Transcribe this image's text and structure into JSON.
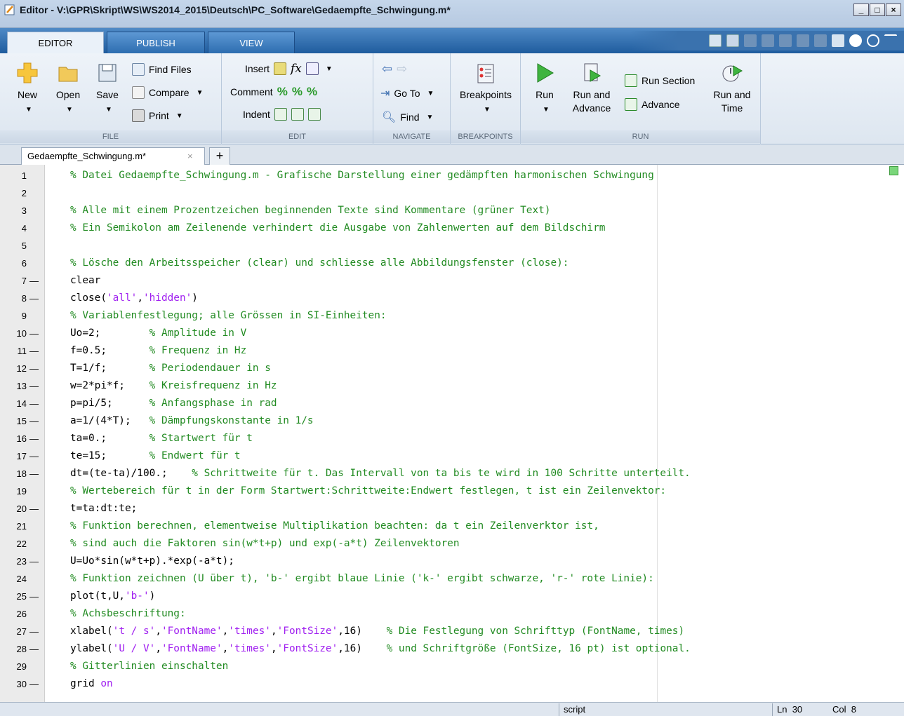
{
  "window": {
    "title": "Editor - V:\\GPR\\Skript\\WS\\WS2014_2015\\Deutsch\\PC_Software\\Gedaempfte_Schwingung.m*",
    "min_glyph": "_",
    "max_glyph": "□",
    "close_glyph": "×"
  },
  "tabs": [
    {
      "label": "EDITOR"
    },
    {
      "label": "PUBLISH"
    },
    {
      "label": "VIEW"
    }
  ],
  "ribbon": {
    "file": {
      "label": "FILE",
      "new": "New",
      "open": "Open",
      "save": "Save",
      "find_files": "Find Files",
      "compare": "Compare",
      "print": "Print"
    },
    "edit": {
      "label": "EDIT",
      "insert": "Insert",
      "comment": "Comment",
      "indent": "Indent"
    },
    "navigate": {
      "label": "NAVIGATE",
      "goto": "Go To",
      "find": "Find"
    },
    "breakpoints": {
      "label": "BREAKPOINTS",
      "breakpoints": "Breakpoints"
    },
    "run": {
      "label": "RUN",
      "run": "Run",
      "run_and_advance_1": "Run and",
      "run_and_advance_2": "Advance",
      "run_section": "Run Section",
      "advance": "Advance",
      "run_and_time_1": "Run and",
      "run_and_time_2": "Time"
    }
  },
  "doc_tab": {
    "label": "Gedaempfte_Schwingung.m*",
    "close": "×",
    "add": "+"
  },
  "lines": [
    {
      "n": "1",
      "b": "",
      "c": "% Datei Gedaempfte_Schwingung.m - Grafische Darstellung einer gedämpften harmonischen Schwingung"
    },
    {
      "n": "2",
      "b": "",
      "c": ""
    },
    {
      "n": "3",
      "b": "",
      "c": "% Alle mit einem Prozentzeichen beginnenden Texte sind Kommentare (grüner Text)"
    },
    {
      "n": "4",
      "b": "",
      "c": "% Ein Semikolon am Zeilenende verhindert die Ausgabe von Zahlenwerten auf dem Bildschirm"
    },
    {
      "n": "5",
      "b": "",
      "c": ""
    },
    {
      "n": "6",
      "b": "",
      "c": "% Lösche den Arbeitsspeicher (clear) und schliesse alle Abbildungsfenster (close):"
    },
    {
      "n": "7",
      "b": "-",
      "c": "clear"
    },
    {
      "n": "8",
      "b": "-",
      "c": "close('all','hidden')"
    },
    {
      "n": "9",
      "b": "",
      "c": "% Variablenfestlegung; alle Grössen in SI-Einheiten:"
    },
    {
      "n": "10",
      "b": "-",
      "c": "Uo=2;        % Amplitude in V"
    },
    {
      "n": "11",
      "b": "-",
      "c": "f=0.5;       % Frequenz in Hz"
    },
    {
      "n": "12",
      "b": "-",
      "c": "T=1/f;       % Periodendauer in s"
    },
    {
      "n": "13",
      "b": "-",
      "c": "w=2*pi*f;    % Kreisfrequenz in Hz"
    },
    {
      "n": "14",
      "b": "-",
      "c": "p=pi/5;      % Anfangsphase in rad"
    },
    {
      "n": "15",
      "b": "-",
      "c": "a=1/(4*T);   % Dämpfungskonstante in 1/s"
    },
    {
      "n": "16",
      "b": "-",
      "c": "ta=0.;       % Startwert für t"
    },
    {
      "n": "17",
      "b": "-",
      "c": "te=15;       % Endwert für t"
    },
    {
      "n": "18",
      "b": "-",
      "c": "dt=(te-ta)/100.;    % Schrittweite für t. Das Intervall von ta bis te wird in 100 Schritte unterteilt."
    },
    {
      "n": "19",
      "b": "",
      "c": "% Wertebereich für t in der Form Startwert:Schrittweite:Endwert festlegen, t ist ein Zeilenvektor:"
    },
    {
      "n": "20",
      "b": "-",
      "c": "t=ta:dt:te;"
    },
    {
      "n": "21",
      "b": "",
      "c": "% Funktion berechnen, elementweise Multiplikation beachten: da t ein Zeilenverktor ist,"
    },
    {
      "n": "22",
      "b": "",
      "c": "% sind auch die Faktoren sin(w*t+p) und exp(-a*t) Zeilenvektoren"
    },
    {
      "n": "23",
      "b": "-",
      "c": "U=Uo*sin(w*t+p).*exp(-a*t);"
    },
    {
      "n": "24",
      "b": "",
      "c": "% Funktion zeichnen (U über t), 'b-' ergibt blaue Linie ('k-' ergibt schwarze, 'r-' rote Linie):"
    },
    {
      "n": "25",
      "b": "-",
      "c": "plot(t,U,'b-')"
    },
    {
      "n": "26",
      "b": "",
      "c": "% Achsbeschriftung:"
    },
    {
      "n": "27",
      "b": "-",
      "c": "xlabel('t / s','FontName','times','FontSize',16)    % Die Festlegung von Schrifttyp (FontName, times)"
    },
    {
      "n": "28",
      "b": "-",
      "c": "ylabel('U / V','FontName','times','FontSize',16)    % und Schriftgröße (FontSize, 16 pt) ist optional."
    },
    {
      "n": "29",
      "b": "",
      "c": "% Gitterlinien einschalten"
    },
    {
      "n": "30",
      "b": "-",
      "c": "grid on"
    }
  ],
  "status": {
    "mode": "script",
    "ln_label": "Ln",
    "ln": "30",
    "col_label": "Col",
    "col": "8"
  },
  "colors": {
    "comment": "#228b22",
    "string": "#a020f0",
    "keyword": "#a020f0",
    "ribbon_tab_bg": "#1f5c9e"
  }
}
